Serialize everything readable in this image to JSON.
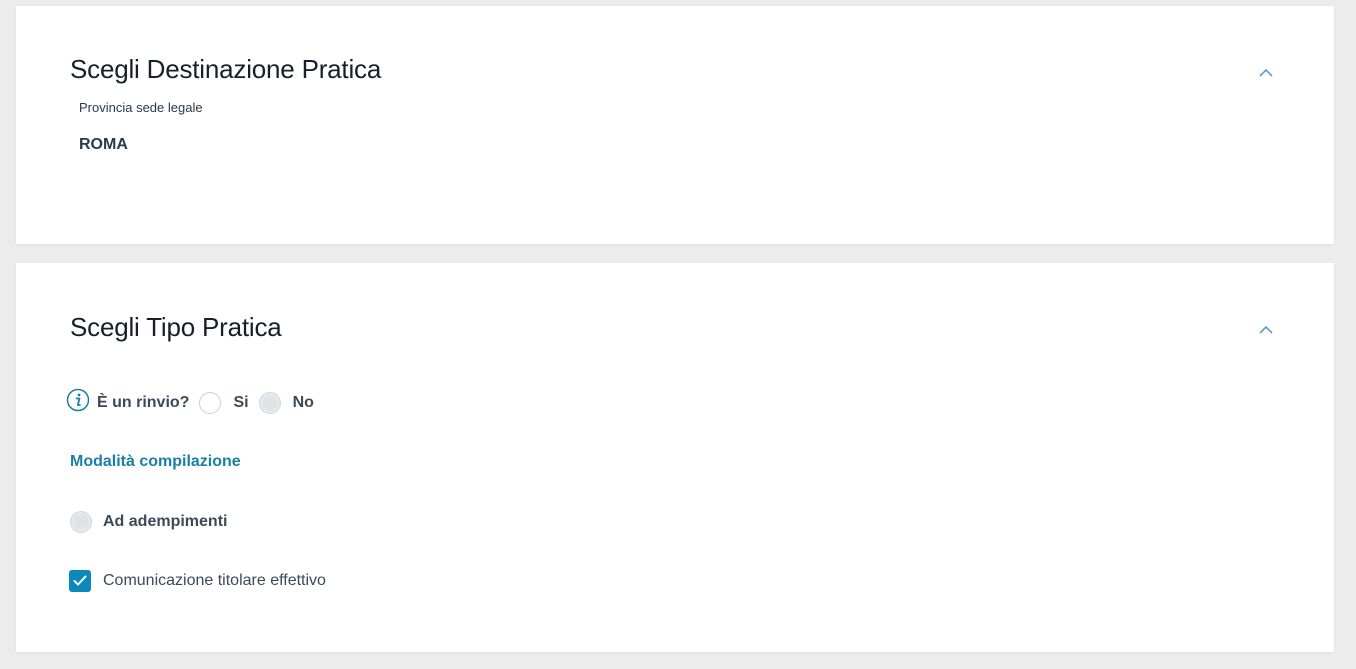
{
  "destinazione": {
    "title": "Scegli Destinazione Pratica",
    "field_label": "Provincia sede legale",
    "field_value": "ROMA",
    "collapse_icon": "chevron-up-icon"
  },
  "tipo_pratica": {
    "title": "Scegli Tipo Pratica",
    "collapse_icon": "chevron-up-icon",
    "rinvio": {
      "info_icon": "info-icon",
      "label": "È un rinvio?",
      "options": [
        {
          "label": "Si",
          "selected": false
        },
        {
          "label": "No",
          "selected": true
        }
      ]
    },
    "modalita_link": "Modalità compilazione",
    "adempimenti": {
      "label": "Ad adempimenti",
      "selected": true
    },
    "comunicazione": {
      "label": "Comunicazione titolare effettivo",
      "checked": true
    }
  },
  "colors": {
    "accent": "#1a7fa6",
    "checkbox": "#0d88b8",
    "background": "#ececec",
    "card": "#ffffff"
  }
}
